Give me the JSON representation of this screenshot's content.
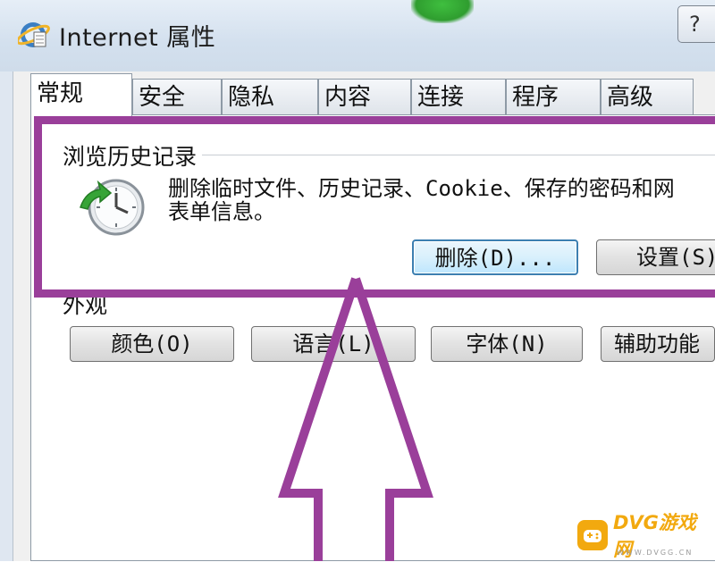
{
  "window": {
    "title": "Internet 属性",
    "help_label": "?"
  },
  "tabs": [
    {
      "label": "常规",
      "active": true
    },
    {
      "label": "安全"
    },
    {
      "label": "隐私"
    },
    {
      "label": "内容"
    },
    {
      "label": "连接"
    },
    {
      "label": "程序"
    },
    {
      "label": "高级"
    }
  ],
  "browsing_history": {
    "group_label": "浏览历史记录",
    "description": "删除临时文件、历史记录、Cookie、保存的密码和网\n表单信息。",
    "delete_button": "删除(D)...",
    "settings_button": "设置(S)"
  },
  "appearance": {
    "group_label": "外观",
    "colors_button": "颜色(O)",
    "languages_button": "语言(L)",
    "fonts_button": "字体(N)",
    "accessibility_button": "辅助功能"
  },
  "annotation": {
    "color": "#9a3f9a"
  },
  "watermark": {
    "brand": "DVG游戏网",
    "sub": "WWW.DVGG.CN",
    "color": "#f2a90f"
  }
}
